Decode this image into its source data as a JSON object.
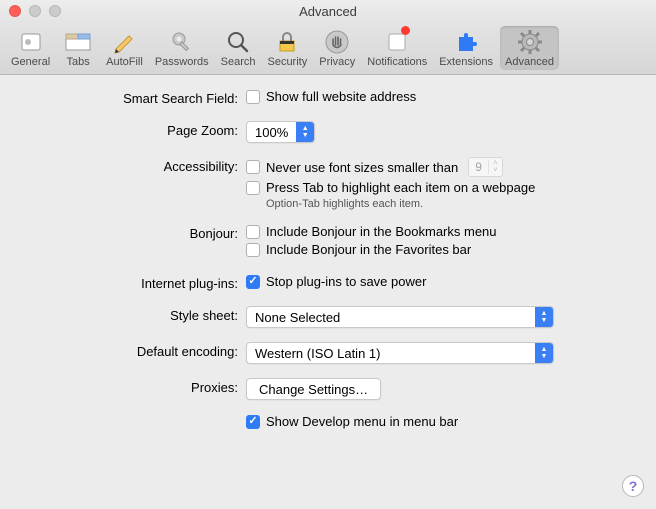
{
  "window": {
    "title": "Advanced"
  },
  "toolbar": [
    {
      "key": "general",
      "label": "General"
    },
    {
      "key": "tabs",
      "label": "Tabs"
    },
    {
      "key": "autofill",
      "label": "AutoFill"
    },
    {
      "key": "passwords",
      "label": "Passwords"
    },
    {
      "key": "search",
      "label": "Search"
    },
    {
      "key": "security",
      "label": "Security"
    },
    {
      "key": "privacy",
      "label": "Privacy"
    },
    {
      "key": "notifications",
      "label": "Notifications",
      "badge": true
    },
    {
      "key": "extensions",
      "label": "Extensions"
    },
    {
      "key": "advanced",
      "label": "Advanced",
      "active": true
    }
  ],
  "labels": {
    "smart_search": "Smart Search Field:",
    "page_zoom": "Page Zoom:",
    "accessibility": "Accessibility:",
    "bonjour": "Bonjour:",
    "plugins": "Internet plug-ins:",
    "stylesheet": "Style sheet:",
    "encoding": "Default encoding:",
    "proxies": "Proxies:"
  },
  "smart_search": {
    "show_full_address": "Show full website address"
  },
  "page_zoom": {
    "value": "100%"
  },
  "accessibility": {
    "never_font_smaller": "Never use font sizes smaller than",
    "font_size": "9",
    "press_tab": "Press Tab to highlight each item on a webpage",
    "hint": "Option-Tab highlights each item."
  },
  "bonjour": {
    "bookmarks": "Include Bonjour in the Bookmarks menu",
    "favorites": "Include Bonjour in the Favorites bar"
  },
  "plugins": {
    "stop_to_save": "Stop plug-ins to save power"
  },
  "stylesheet": {
    "value": "None Selected"
  },
  "encoding": {
    "value": "Western (ISO Latin 1)"
  },
  "proxies": {
    "button": "Change Settings…"
  },
  "develop": {
    "show_menu": "Show Develop menu in menu bar"
  }
}
